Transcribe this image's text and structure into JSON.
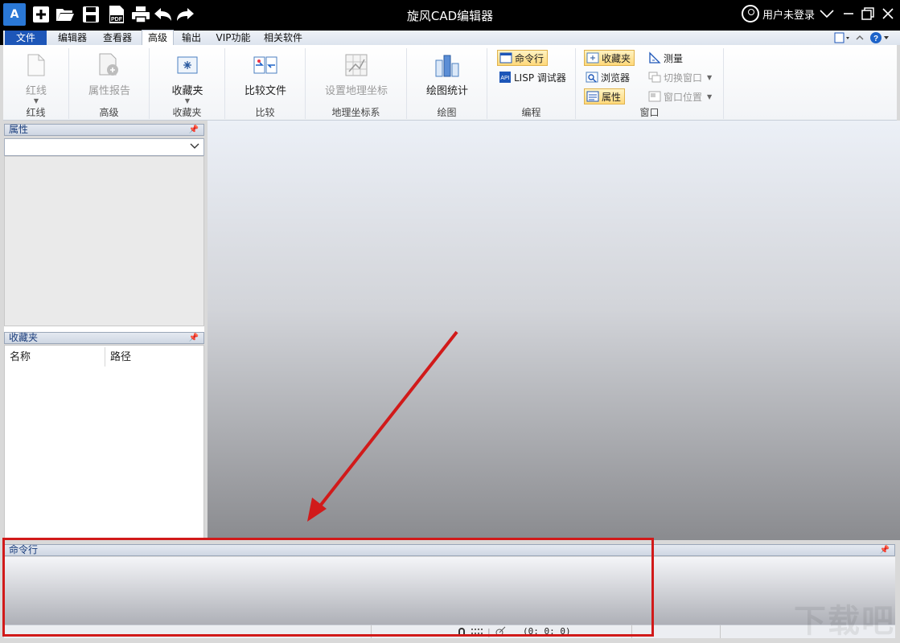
{
  "app": {
    "title": "旋风CAD编辑器",
    "logo_text": "A",
    "user_label": "用户未登录"
  },
  "quick_access": [
    "new-file-icon",
    "open-folder-icon",
    "save-icon",
    "export-pdf-icon",
    "print-icon",
    "undo-icon",
    "redo-icon"
  ],
  "pdf_badge": "PDF",
  "menu": {
    "tabs": [
      {
        "label": "文件"
      },
      {
        "label": "编辑器"
      },
      {
        "label": "查看器"
      },
      {
        "label": "高级"
      },
      {
        "label": "输出"
      },
      {
        "label": "VIP功能"
      },
      {
        "label": "相关软件"
      }
    ],
    "active": "高级"
  },
  "ribbon": {
    "groups": {
      "redline": {
        "label": "红线",
        "button": "红线"
      },
      "advanced": {
        "label": "高级",
        "button": "属性报告"
      },
      "favorites": {
        "label": "收藏夹",
        "button": "收藏夹"
      },
      "compare": {
        "label": "比较",
        "button": "比较文件"
      },
      "geo": {
        "label": "地理坐标系",
        "button": "设置地理坐标"
      },
      "drawing": {
        "label": "绘图",
        "button": "绘图统计"
      },
      "programming": {
        "label": "编程",
        "cmdline": "命令行",
        "lisp": "LISP 调试器"
      },
      "window": {
        "label": "窗口",
        "favorites": "收藏夹",
        "browser": "浏览器",
        "properties": "属性",
        "measure": "测量",
        "switch_window": "切换窗口",
        "window_position": "窗口位置"
      }
    }
  },
  "panels": {
    "properties": {
      "title": "属性"
    },
    "favorites": {
      "title": "收藏夹",
      "columns": [
        "名称",
        "路径"
      ]
    },
    "command_line": {
      "title": "命令行"
    }
  },
  "status": {
    "coords": "(0; 0; 0)"
  },
  "colors": {
    "accent": "#1d56b8",
    "highlight": "#d11a1a",
    "title_bg": "#000000"
  },
  "watermark": "下载吧"
}
